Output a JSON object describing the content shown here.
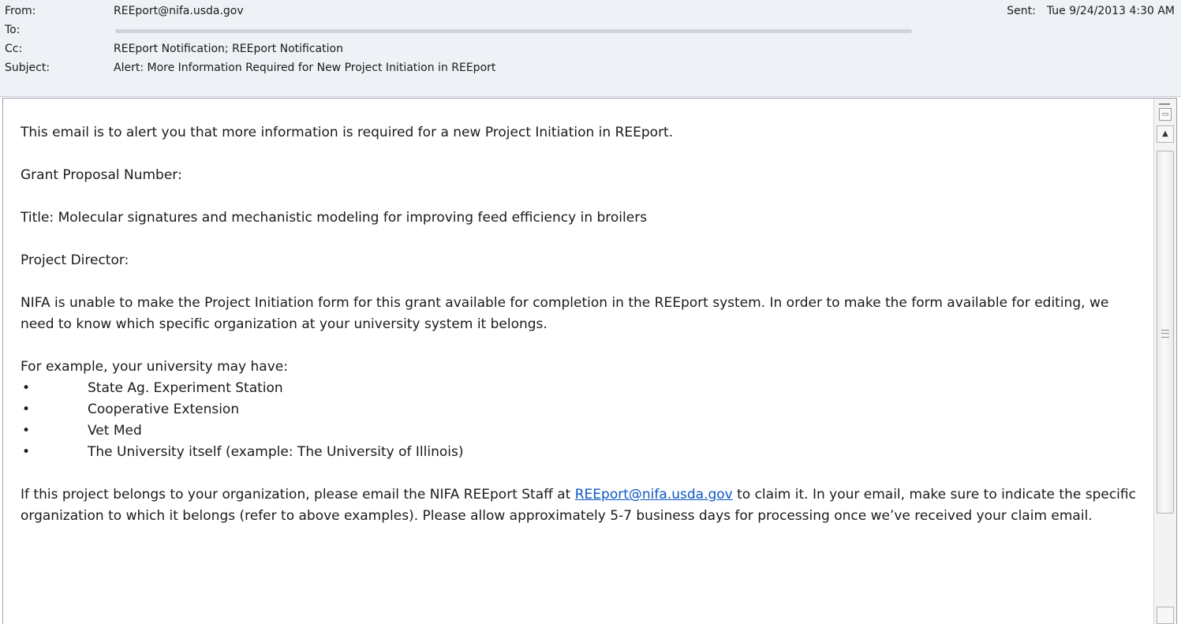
{
  "header": {
    "from_label": "From:",
    "from_value": "REEport@nifa.usda.gov",
    "to_label": "To:",
    "to_value": "",
    "cc_label": "Cc:",
    "cc_value": "REEport Notification; REEport Notification",
    "subject_label": "Subject:",
    "subject_value": "Alert: More Information Required for New Project Initiation in REEport",
    "sent_label": "Sent:",
    "sent_value": "Tue 9/24/2013 4:30 AM"
  },
  "body": {
    "intro": "This email is to alert you that more information is required for a new Project Initiation in REEport.",
    "grant_label": "Grant Proposal Number:",
    "title_line": "Title:  Molecular signatures and mechanistic modeling for improving feed efficiency in broilers",
    "director_label": "Project Director:",
    "nifa_paragraph": "NIFA is unable to make the Project Initiation form for this grant available for completion in the REEport system.  In order to make the form available for editing, we need to know which specific organization at your university system it belongs.",
    "example_intro": "For example, your university may have:",
    "bullet_symbol": "•",
    "bullets": [
      "State Ag. Experiment Station",
      "Cooperative Extension",
      "Vet Med",
      "The University itself (example: The University of Illinois)"
    ],
    "claim_before_link": "If this project belongs to your organization, please email the NIFA REEport Staff at ",
    "claim_link": "REEport@nifa.usda.gov",
    "claim_after_link": " to claim it.  In your email, make sure to indicate the specific organization to which it belongs (refer to above examples).  Please allow approximately 5-7 business days for processing once we’ve received your claim email."
  },
  "scrollbar": {
    "mini_icon": "document-icon",
    "up_arrow": "▲",
    "colors": {
      "header_bg": "#eef1f6",
      "link": "#0b55c5"
    }
  }
}
